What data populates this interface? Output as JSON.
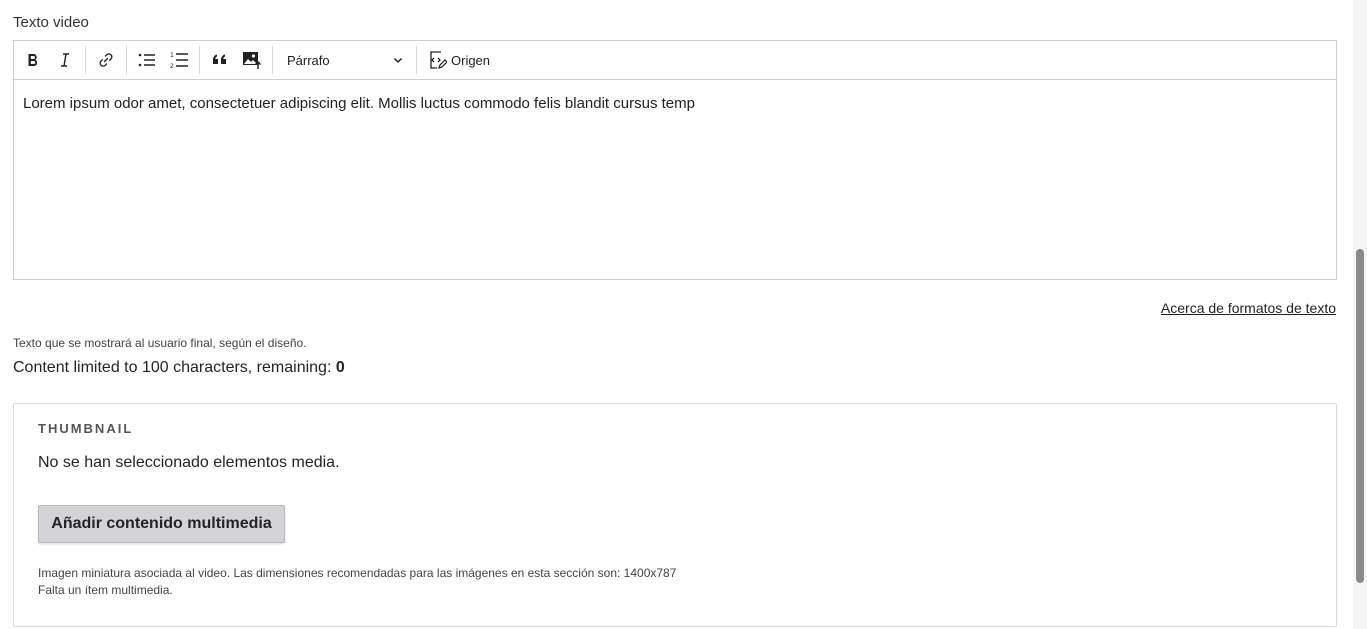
{
  "field": {
    "label": "Texto video"
  },
  "toolbar": {
    "bold_icon": "bold-icon",
    "italic_icon": "italic-icon",
    "link_icon": "link-icon",
    "bullet_list_icon": "bulleted-list-icon",
    "numbered_list_icon": "numbered-list-icon",
    "blockquote_icon": "blockquote-icon",
    "insert_image_icon": "insert-image-icon",
    "heading_select": "Párrafo",
    "source_label": "Origen"
  },
  "editor": {
    "content": "Lorem ipsum odor amet, consectetuer adipiscing elit. Mollis luctus commodo felis blandit cursus temp"
  },
  "formats_link": "Acerca de formatos de texto",
  "help_text": "Texto que se mostrará al usuario final, según el diseño.",
  "limit": {
    "prefix": "Content limited to 100 characters, remaining: ",
    "remaining": "0"
  },
  "thumbnail": {
    "legend": "THUMBNAIL",
    "empty_message": "No se han seleccionado elementos media.",
    "add_button": "Añadir contenido multimedia",
    "description": "Imagen miniatura asociada al video. Las dimensiones recomendadas para las imágenes en esta sección son: 1400x787",
    "missing": "Falta un ítem multimedia."
  }
}
